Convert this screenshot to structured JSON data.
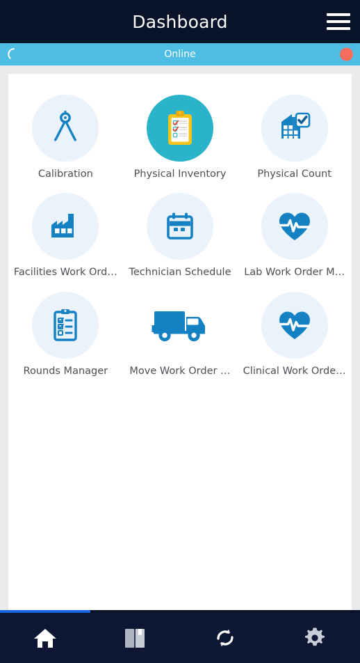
{
  "header": {
    "title": "Dashboard",
    "menu_icon": "hamburger-menu-icon"
  },
  "status": {
    "label": "Online",
    "spinner_icon": "loading-spinner-icon",
    "indicator_icon": "status-dot-icon",
    "indicator_color": "#f96d5e",
    "bar_color": "#4ebde4"
  },
  "grid": {
    "tiles": [
      {
        "label": "Calibration",
        "icon": "compass-divider-icon",
        "style": "halo"
      },
      {
        "label": "Physical Inventory",
        "icon": "clipboard-checklist-icon",
        "style": "teal"
      },
      {
        "label": "Physical Count",
        "icon": "warehouse-check-icon",
        "style": "halo"
      },
      {
        "label": "Facilities Work Ord…",
        "icon": "factory-icon",
        "style": "halo"
      },
      {
        "label": "Technician Schedule",
        "icon": "calendar-icon",
        "style": "halo"
      },
      {
        "label": "Lab Work Order M…",
        "icon": "heart-pulse-icon",
        "style": "halo"
      },
      {
        "label": "Rounds Manager",
        "icon": "clipboard-tasks-icon",
        "style": "halo"
      },
      {
        "label": "Move Work Order …",
        "icon": "delivery-truck-icon",
        "style": "plain"
      },
      {
        "label": "Clinical Work Orde…",
        "icon": "heart-pulse-icon",
        "style": "halo"
      }
    ]
  },
  "progress": {
    "percent": 25,
    "fill_color": "#1565d8"
  },
  "bottom_nav": {
    "items": [
      {
        "icon": "home-icon"
      },
      {
        "icon": "book-bookmark-icon"
      },
      {
        "icon": "sync-refresh-icon"
      },
      {
        "icon": "gear-settings-icon"
      }
    ]
  },
  "colors": {
    "header_bg": "#081229",
    "accent_blue": "#1481c2",
    "halo_blue": "#eaf2fb",
    "teal": "#2bb3ca"
  }
}
